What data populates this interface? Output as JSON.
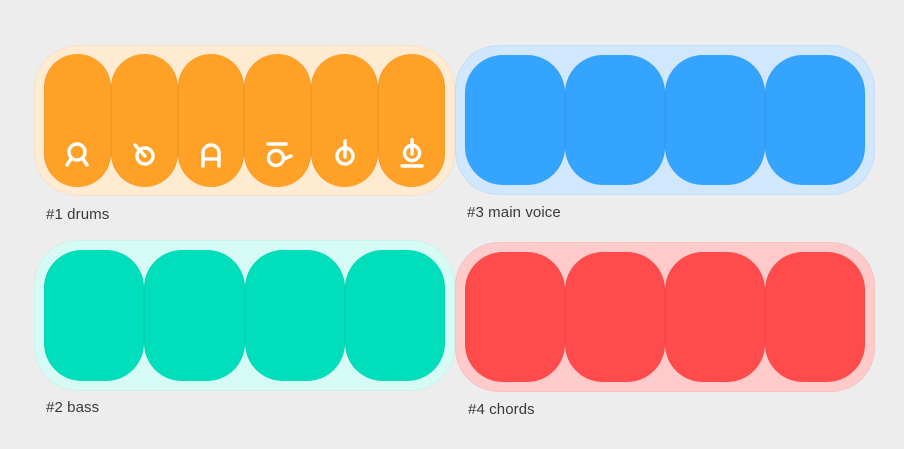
{
  "tracks": [
    {
      "id": "drums",
      "label": "#1 drums",
      "pad_color": "#ffa127",
      "panel_color": "#ffebd2",
      "pads": [
        {
          "icon": "drum-kick-icon"
        },
        {
          "icon": "drum-snare-icon"
        },
        {
          "icon": "drum-tom-icon"
        },
        {
          "icon": "drum-hihat-icon"
        },
        {
          "icon": "drum-cymbal-icon"
        },
        {
          "icon": "drum-ride-icon"
        }
      ]
    },
    {
      "id": "main-voice",
      "label": "#3 main voice",
      "pad_color": "#35a4ff",
      "panel_color": "#d1e7fd",
      "pads": [
        {},
        {},
        {},
        {}
      ]
    },
    {
      "id": "bass",
      "label": "#2 bass",
      "pad_color": "#00debc",
      "panel_color": "#d6fbf4",
      "pads": [
        {},
        {},
        {},
        {}
      ]
    },
    {
      "id": "chords",
      "label": "#4 chords",
      "pad_color": "#ff4b4b",
      "panel_color": "#ffcaca",
      "pads": [
        {},
        {},
        {},
        {}
      ]
    }
  ]
}
